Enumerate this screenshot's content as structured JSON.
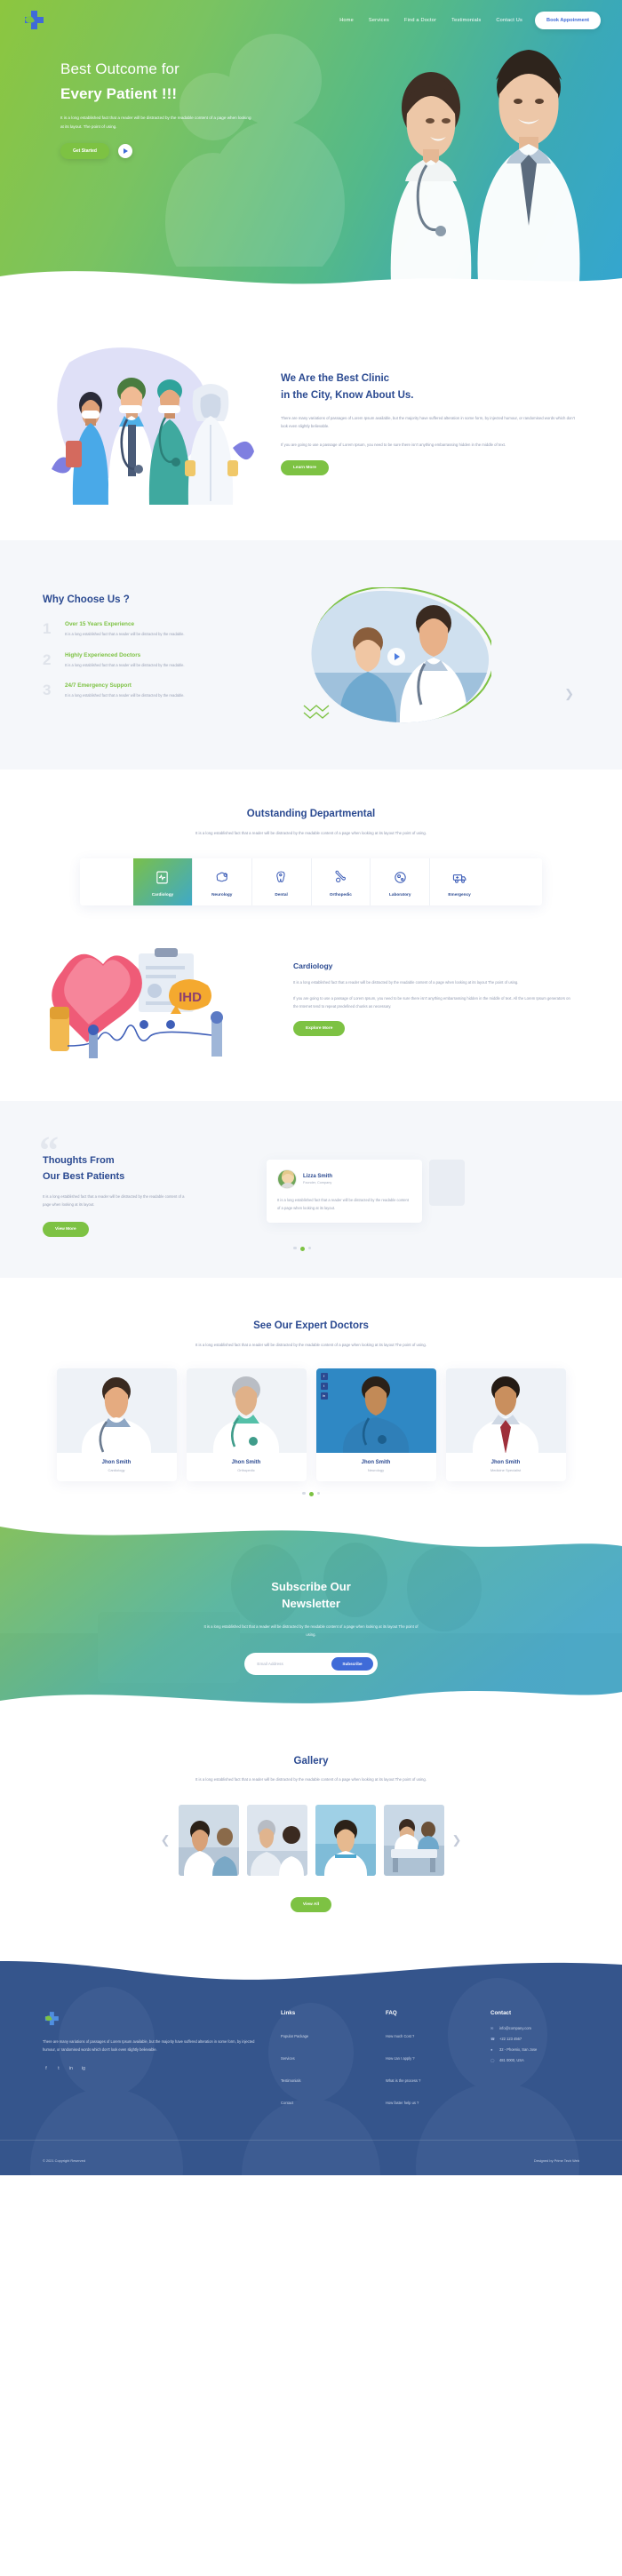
{
  "nav": {
    "logo_name": "medical-cross-logo",
    "links": [
      "Home",
      "Services",
      "Find a Doctor",
      "Testimonials",
      "Contact Us"
    ],
    "book_label": "Book Appoinment"
  },
  "hero": {
    "title_line1": "Best Outcome for",
    "title_line2": "Every Patient !!!",
    "paragraph": "It is a long established fact that a reader will be distracted by the readable content of a page when looking at its layout. The point of using.",
    "cta_label": "Get Started",
    "play_label": "play-video"
  },
  "about": {
    "title_line1": "We Are the Best Clinic",
    "title_line2": "in the City, Know About Us.",
    "p1": "There are many variations of passages of Lorem Ipsum available, but the majority have suffered alteration in some form, by injected humour, or randomised words which don't look even slightly believable.",
    "p2": "If you are going to use a passage of Lorem Ipsum, you need to be sure there isn't anything embarrassing hidden in the middle of text.",
    "cta_label": "Learn More"
  },
  "why": {
    "title": "Why Choose Us ?",
    "items": [
      {
        "num": "1",
        "title": "Over 15 Years Experience",
        "text": "It is a long established fact that a reader will be distracted by the readable."
      },
      {
        "num": "2",
        "title": "Highly Experienced Doctors",
        "text": "It is a long established fact that a reader will be distracted by the readable."
      },
      {
        "num": "3",
        "title": "24/7 Emergency Support",
        "text": "It is a long established fact that a reader will be distracted by the readable."
      }
    ],
    "prev_arrow": "❮",
    "next_arrow": "❯"
  },
  "departments": {
    "title": "Outstanding Departmental",
    "subtitle": "It is a long established fact that a reader will be distracted by the readable content of a page when looking at its layout The point of using.",
    "tabs": [
      {
        "label": "Cardiology",
        "icon": "heart-monitor-icon",
        "active": true
      },
      {
        "label": "Neurology",
        "icon": "brain-icon",
        "active": false
      },
      {
        "label": "Dental",
        "icon": "tooth-icon",
        "active": false
      },
      {
        "label": "Orthopedic",
        "icon": "bone-joint-icon",
        "active": false
      },
      {
        "label": "Laboratory",
        "icon": "microscope-icon",
        "active": false
      },
      {
        "label": "Emergency",
        "icon": "ambulance-icon",
        "active": false
      }
    ],
    "detail": {
      "badge": "IHD",
      "title": "Cardiology",
      "p1": "It is a long established fact that a reader will be distracted by the readable content of a page when looking at its layout The point of using.",
      "p2": "If you are going to use a passage of Lorem Ipsum, you need to be sure there isn't anything embarrassing hidden in the middle of text. All the Lorem Ipsum generators on the Internet tend to repeat predefined chunks as necessary.",
      "cta_label": "Explore More"
    }
  },
  "testimonials": {
    "title_line1": "Thoughts From",
    "title_line2": "Our Best Patients",
    "paragraph": "It is a long established fact that a reader will be distracted by the readable content of a page when looking at its layout.",
    "cta_label": "View More",
    "card": {
      "name": "Lizza Smith",
      "role": "Founder, Company",
      "text": "It is a long established fact that a reader will be distracted by the readable content of a page when looking at its layout."
    },
    "dots": [
      "inactive",
      "active",
      "inactive"
    ]
  },
  "doctors": {
    "title": "See Our Expert Doctors",
    "subtitle": "It is a long established fact that a reader will be distracted by the readable content of a page when looking at its layout The point of using.",
    "cards": [
      {
        "name": "Jhon Smith",
        "specialty": "Cardiology",
        "has_social": false
      },
      {
        "name": "Jhon Smith",
        "specialty": "Orthopedic",
        "has_social": false
      },
      {
        "name": "Jhon Smith",
        "specialty": "Neurology",
        "has_social": true
      },
      {
        "name": "Jhon Smith",
        "specialty": "Medicine Specialist",
        "has_social": false
      }
    ],
    "social": [
      "f",
      "t",
      "in"
    ],
    "dots": [
      "inactive",
      "active",
      "inactive"
    ]
  },
  "newsletter": {
    "title_line1": "Subscribe Our",
    "title_line2": "Newsletter",
    "paragraph": "It is a long established fact that a reader will be distracted by the readable content of a page when looking at its layout The point of using.",
    "placeholder": "Email Address",
    "button_label": "Subscribe"
  },
  "gallery": {
    "title": "Gallery",
    "subtitle": "It is a long established fact that a reader will be distracted by the readable content of a page when looking at its layout The point of using.",
    "prev_arrow": "❮",
    "next_arrow": "❯",
    "cta_label": "View All",
    "items": [
      "gallery-image-1",
      "gallery-image-2",
      "gallery-image-3",
      "gallery-image-4"
    ]
  },
  "footer": {
    "about": "There are many variations of passages of Lorem Ipsum available, but the majority have suffered alteration in some form, by injected humour, or randomised words which don't look even slightly believable.",
    "social": [
      "f",
      "t",
      "in",
      "ig"
    ],
    "links_title": "Links",
    "links": [
      "Popular Package",
      "Services",
      "Testimonials",
      "Contact"
    ],
    "faq_title": "FAQ",
    "faq": [
      "How much Cost ?",
      "How can I apply ?",
      "What is the process ?",
      "How faster help us ?"
    ],
    "contact_title": "Contact",
    "contacts": [
      {
        "icon": "mail-icon",
        "text": "info@company.com"
      },
      {
        "icon": "phone-icon",
        "text": "+22 123 4567"
      },
      {
        "icon": "location-icon",
        "text": "32 - Phoenix, San Jose"
      },
      {
        "icon": "clock-icon",
        "text": "481 0000, USA"
      }
    ],
    "copyright": "© 2021 Copyright Reserved",
    "credit": "Designed by Prime Tech Web"
  },
  "colors": {
    "green": "#7dc243",
    "blue": "#2b4a91",
    "accent_blue": "#3f6bd8",
    "footer_bg": "#2f4f87",
    "light_bg": "#f5f7fa"
  }
}
